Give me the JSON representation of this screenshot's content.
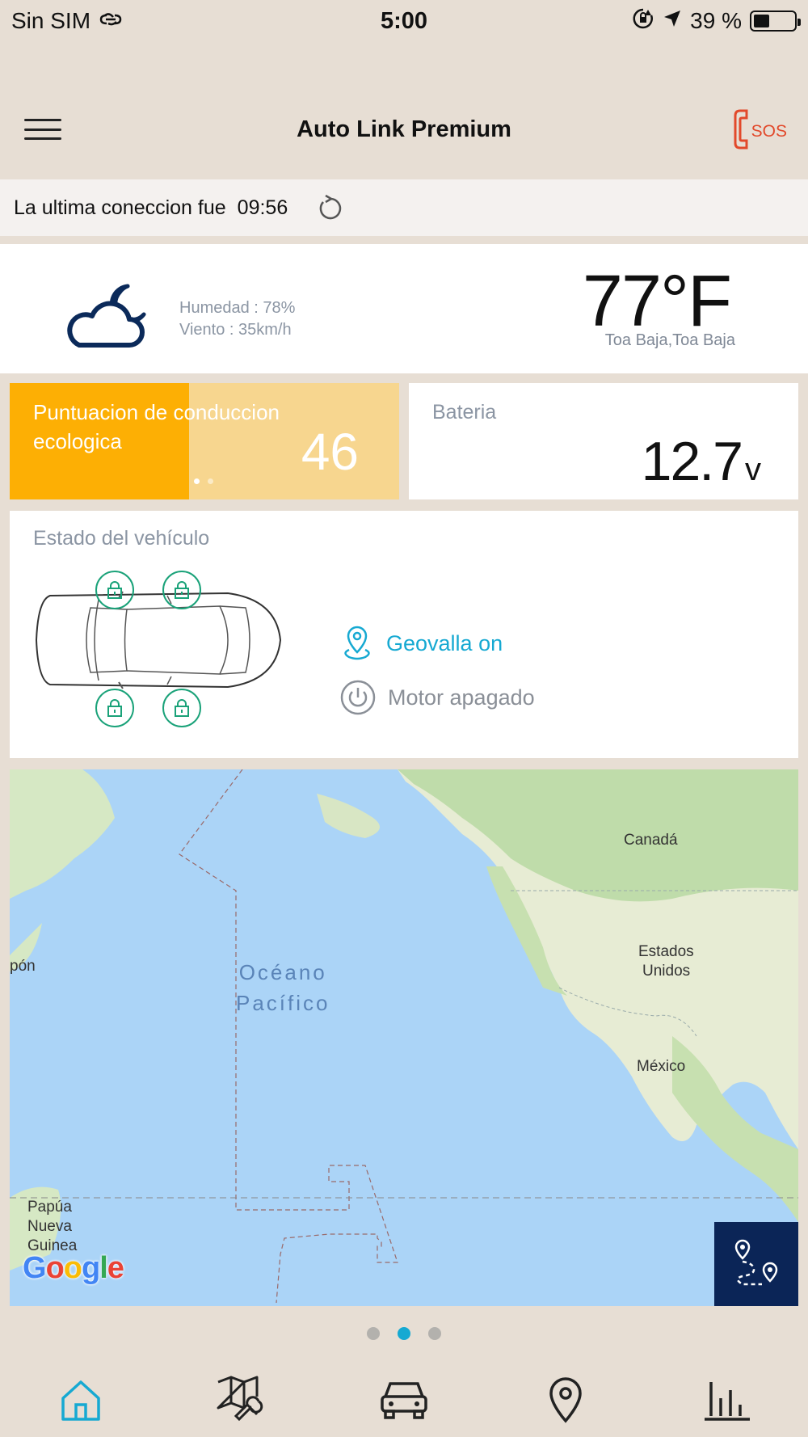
{
  "status_bar": {
    "carrier": "Sin SIM",
    "time": "5:00",
    "battery_percent": "39 %",
    "battery_level": 0.39
  },
  "header": {
    "title": "Auto Link Premium",
    "sos_label": "SOS"
  },
  "connection": {
    "label": "La ultima coneccion fue",
    "time": "09:56"
  },
  "weather": {
    "humidity": "Humedad : 78%",
    "wind": "Viento : 35km/h",
    "temperature": "77°F",
    "location": "Toa Baja,Toa Baja",
    "icon": "cloud-moon-icon"
  },
  "eco_score": {
    "label": "Puntuacion de conduccion ecologica",
    "value": "46",
    "fill_fraction": 0.46
  },
  "battery": {
    "label": "Bateria",
    "value": "12.7",
    "unit": "v"
  },
  "vehicle": {
    "title": "Estado del vehículo",
    "geofence": "Geovalla on",
    "engine": "Motor apagado"
  },
  "map": {
    "labels": {
      "canada": "Canadá",
      "usa_line1": "Estados",
      "usa_line2": "Unidos",
      "mexico": "México",
      "japan": "pón",
      "ocean_line1": "Océano",
      "ocean_line2": "Pacífico",
      "png_line1": "Papúa",
      "png_line2": "Nueva",
      "png_line3": "Guinea"
    },
    "logo": "Google"
  },
  "pager": {
    "count": 3,
    "active": 1
  },
  "tabs": [
    "home-icon",
    "map-service-icon",
    "car-icon",
    "location-pin-icon",
    "bar-chart-icon"
  ],
  "colors": {
    "eco_orange": "#fdaf04",
    "accent_blue": "#16a9d2",
    "lock_green": "#1aa279",
    "sos_red": "#e2492b",
    "navy": "#0b2557"
  }
}
